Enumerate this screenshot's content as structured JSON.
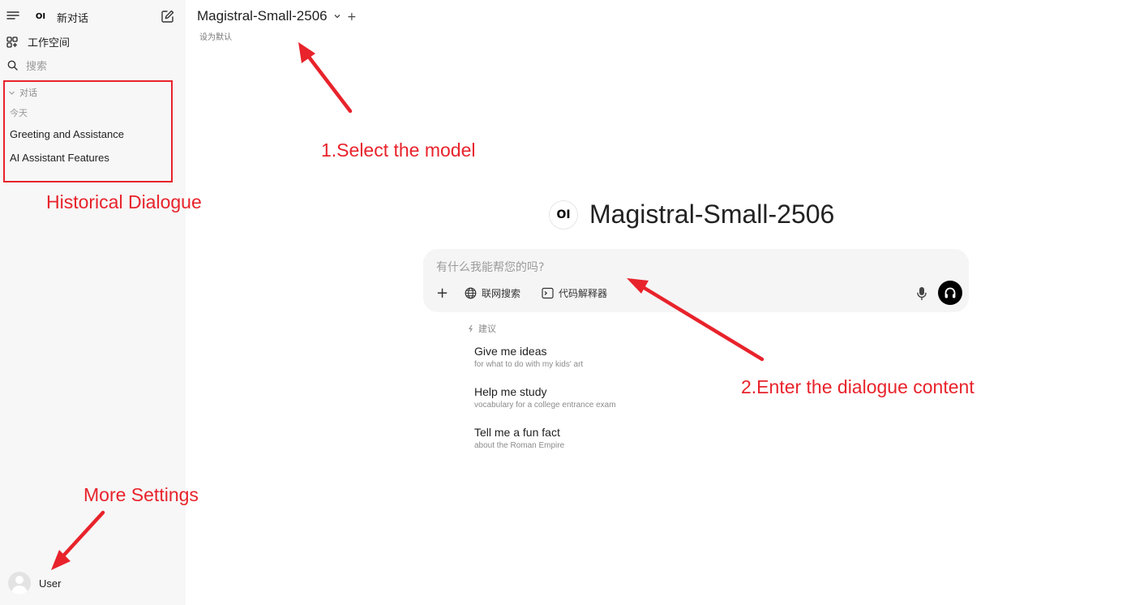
{
  "sidebar": {
    "new_chat_label": "新对话",
    "logo_text": "OI",
    "workspace_label": "工作空间",
    "search_placeholder": "搜索",
    "conversations_section_label": "对话",
    "today_label": "今天",
    "history": [
      {
        "title": "Greeting and Assistance"
      },
      {
        "title": "AI Assistant Features"
      }
    ],
    "user_name": "User"
  },
  "topbar": {
    "model_name": "Magistral-Small-2506",
    "add_model_symbol": "+",
    "set_default_label": "设为默认"
  },
  "main": {
    "logo_text": "OI",
    "hero_title": "Magistral-Small-2506",
    "chat_placeholder": "有什么我能帮您的吗?",
    "plus_symbol": "+",
    "web_search_label": "联网搜索",
    "code_interpreter_label": "代码解释器",
    "suggestions_header": "建议",
    "suggestions": [
      {
        "title": "Give me ideas",
        "subtitle": "for what to do with my kids' art"
      },
      {
        "title": "Help me study",
        "subtitle": "vocabulary for a college entrance exam"
      },
      {
        "title": "Tell me a fun fact",
        "subtitle": "about the Roman Empire"
      }
    ]
  },
  "annotations": {
    "select_model": "1.Select the model",
    "historical_dialogue": "Historical Dialogue",
    "enter_content": "2.Enter the dialogue content",
    "more_settings": "More Settings",
    "color": "#e8232b"
  },
  "icons": {
    "menu": "menu-icon",
    "edit": "edit-icon",
    "workspace": "grid-icon",
    "search": "search-icon",
    "chevron": "chevron-down-icon",
    "globe": "globe-icon",
    "terminal": "terminal-icon",
    "mic": "mic-icon",
    "headphones": "headphones-icon",
    "sparkle": "sparkle-icon"
  }
}
